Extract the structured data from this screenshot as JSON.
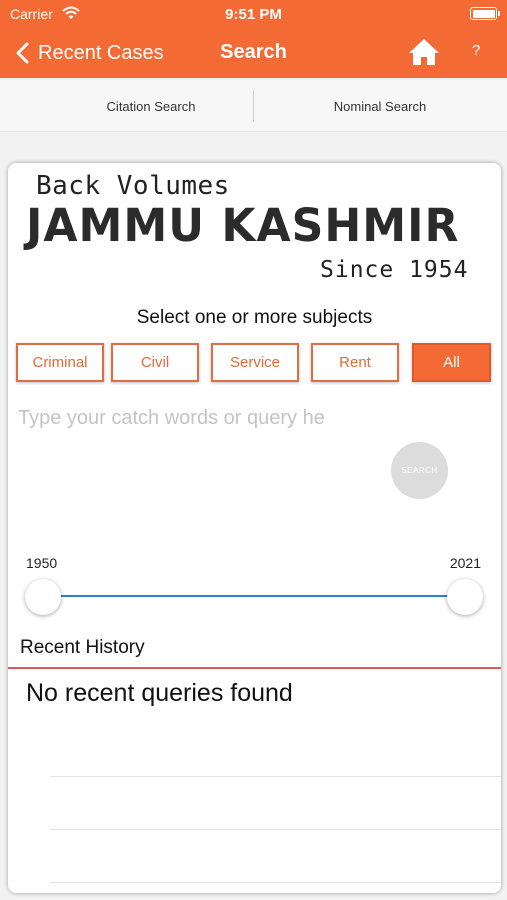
{
  "status_bar": {
    "carrier": "Carrier",
    "time": "9:51 PM"
  },
  "nav": {
    "back_label": "Recent Cases",
    "title": "Search",
    "help": "?"
  },
  "tabs": [
    {
      "label": "Citation Search"
    },
    {
      "label": "Nominal Search"
    }
  ],
  "logo": {
    "line1": "Back Volumes",
    "line2": "JAMMU KASHMIR",
    "line3": "Since 1954"
  },
  "subjects": {
    "label": "Select one or more subjects",
    "options": [
      "Criminal",
      "Civil",
      "Service",
      "Rent",
      "All"
    ],
    "selected": "All"
  },
  "query": {
    "placeholder": "Type your catch words or query he",
    "value": ""
  },
  "search_button": {
    "label": "SEARCH"
  },
  "year_range": {
    "min_label": "1950",
    "max_label": "2021"
  },
  "history": {
    "title": "Recent History",
    "empty_message": "No recent queries found"
  },
  "colors": {
    "accent": "#f36a35",
    "slider": "#2b7fd6",
    "history_rule": "#e05a5a"
  }
}
